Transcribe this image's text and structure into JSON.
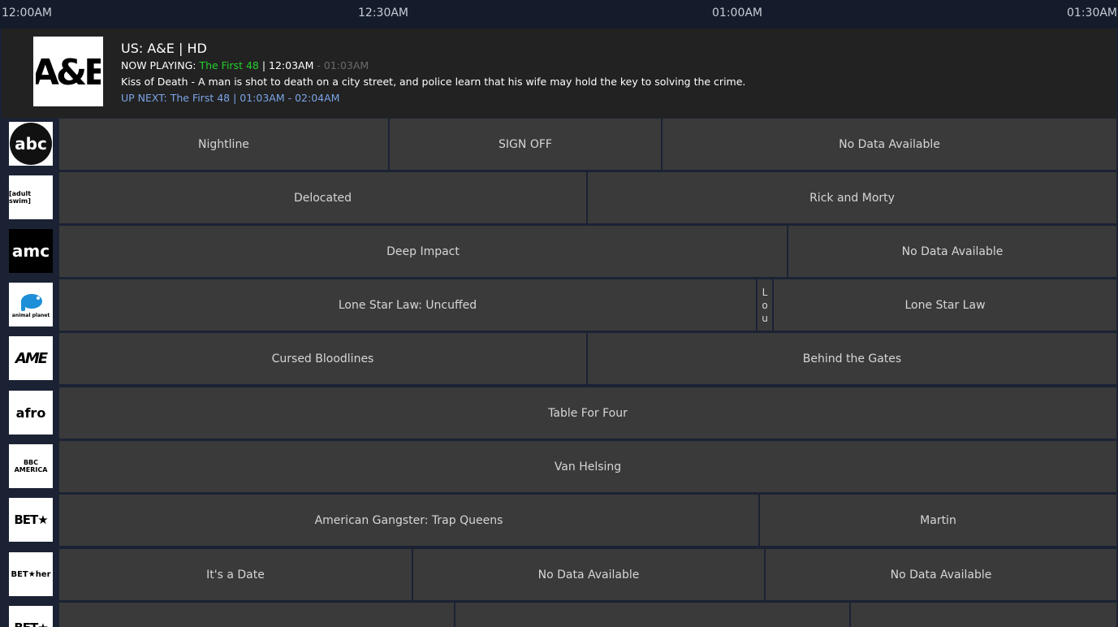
{
  "timebar": {
    "times": [
      "12:00AM",
      "12:30AM",
      "01:00AM",
      "01:30AM"
    ]
  },
  "info": {
    "channel": "US: A&E | HD",
    "now_prefix": "NOW PLAYING: ",
    "now_show": "The First 48",
    "now_sep": " | ",
    "now_start": "12:03AM",
    "now_end": " - 01:03AM",
    "description": "Kiss of Death - A man is shot to death on a city street, and police learn that his wife may hold the key to solving the crime.",
    "up_next": "UP NEXT: The First 48 | 01:03AM - 02:04AM",
    "logo": "A&E"
  },
  "rows": [
    {
      "logo_text": "abc",
      "programs": [
        "Nightline",
        "SIGN OFF",
        "No Data Available"
      ]
    },
    {
      "logo_text": "[adult swim]",
      "programs": [
        "Delocated",
        "Rick and Morty"
      ]
    },
    {
      "logo_text": "amc",
      "programs": [
        "Deep Impact",
        "No Data Available"
      ]
    },
    {
      "logo_text": "animal planet",
      "programs": [
        "Lone Star Law: Uncuffed",
        "L o u",
        "Lone Star Law"
      ]
    },
    {
      "logo_text": "AME",
      "programs": [
        "Cursed Bloodlines",
        "Behind the Gates"
      ]
    },
    {
      "logo_text": "afro",
      "programs": [
        "Table For Four"
      ]
    },
    {
      "logo_text": "BBC AMERICA",
      "programs": [
        "Van Helsing"
      ]
    },
    {
      "logo_text": "BET★",
      "programs": [
        "American Gangster: Trap Queens",
        "Martin"
      ]
    },
    {
      "logo_text": "BET★her",
      "programs": [
        "It's a Date",
        "No Data Available",
        "No Data Available"
      ]
    },
    {
      "logo_text": "BET★",
      "programs": [
        "",
        "",
        ""
      ]
    }
  ],
  "colors": {
    "background": "#1b2234",
    "cell": "#3a3a3a",
    "now_show": "#24d02a",
    "up_next": "#7aa4e6"
  }
}
